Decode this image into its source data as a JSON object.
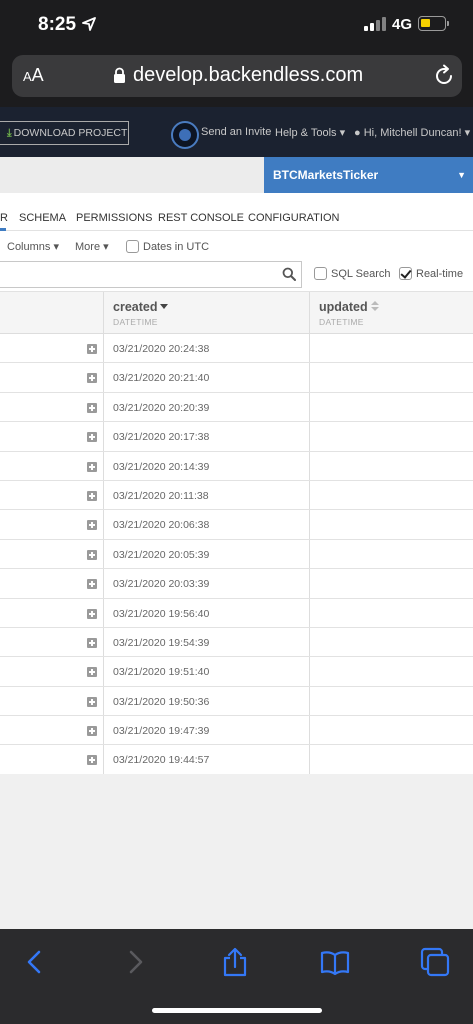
{
  "status_bar": {
    "time": "8:25",
    "network": "4G"
  },
  "browser": {
    "aa_label": "AA",
    "url": "develop.backendless.com"
  },
  "header": {
    "download_label": "DOWNLOAD PROJECT",
    "send_invite": "Send an Invite",
    "help_tools": "Help & Tools ▾",
    "user_greeting": "Hi, Mitchell Duncan! ▾"
  },
  "app_selector": {
    "name": "BTCMarketsTicker"
  },
  "tabs": [
    {
      "label": "R"
    },
    {
      "label": "SCHEMA"
    },
    {
      "label": "PERMISSIONS"
    },
    {
      "label": "REST CONSOLE"
    },
    {
      "label": "CONFIGURATION"
    }
  ],
  "toolbar": {
    "columns_label": "Columns ▾",
    "more_label": "More ▾",
    "dates_utc_label": "Dates in UTC",
    "dates_utc_checked": false
  },
  "search": {
    "placeholder": "",
    "sql_search_label": "SQL Search",
    "sql_search_checked": false,
    "realtime_label": "Real-time",
    "realtime_checked": true
  },
  "table": {
    "columns": [
      {
        "name": "created",
        "type": "DATETIME",
        "sort": "desc"
      },
      {
        "name": "updated",
        "type": "DATETIME",
        "sort": "none"
      }
    ],
    "rows": [
      {
        "created": "03/21/2020 20:24:38",
        "updated": ""
      },
      {
        "created": "03/21/2020 20:21:40",
        "updated": ""
      },
      {
        "created": "03/21/2020 20:20:39",
        "updated": ""
      },
      {
        "created": "03/21/2020 20:17:38",
        "updated": ""
      },
      {
        "created": "03/21/2020 20:14:39",
        "updated": ""
      },
      {
        "created": "03/21/2020 20:11:38",
        "updated": ""
      },
      {
        "created": "03/21/2020 20:06:38",
        "updated": ""
      },
      {
        "created": "03/21/2020 20:05:39",
        "updated": ""
      },
      {
        "created": "03/21/2020 20:03:39",
        "updated": ""
      },
      {
        "created": "03/21/2020 19:56:40",
        "updated": ""
      },
      {
        "created": "03/21/2020 19:54:39",
        "updated": ""
      },
      {
        "created": "03/21/2020 19:51:40",
        "updated": ""
      },
      {
        "created": "03/21/2020 19:50:36",
        "updated": ""
      },
      {
        "created": "03/21/2020 19:47:39",
        "updated": ""
      },
      {
        "created": "03/21/2020 19:44:57",
        "updated": ""
      }
    ]
  },
  "bottom_toolbar": {
    "icons": [
      "back-icon",
      "forward-icon",
      "share-icon",
      "bookmarks-icon",
      "tabs-icon"
    ]
  },
  "colors": {
    "accent": "#3f7cc2",
    "header_bg": "#1b2230",
    "browser_chrome": "#1c1c1e",
    "ios_blue": "#3478f6",
    "battery": "#f5d000",
    "download_icon": "#6fb04a"
  }
}
